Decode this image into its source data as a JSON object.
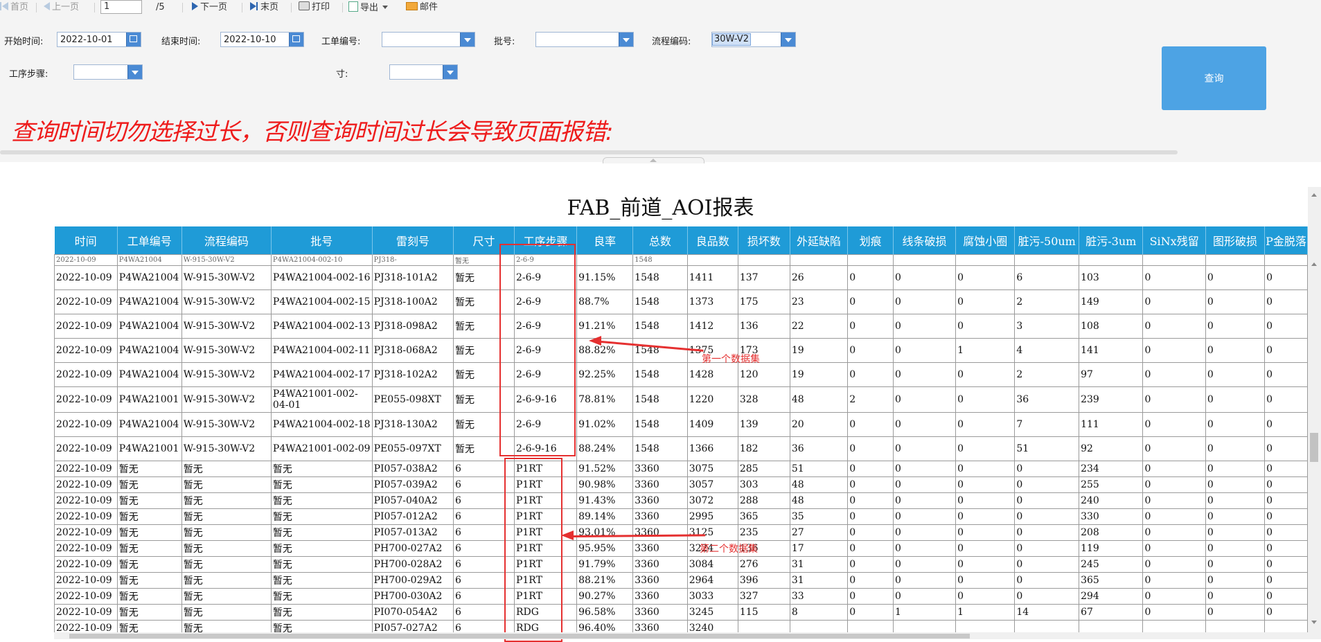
{
  "toolbar": {
    "first": "首页",
    "prev": "上一页",
    "page_value": "1",
    "page_total": "/5",
    "next": "下一页",
    "last": "末页",
    "print": "打印",
    "export": "导出",
    "mail": "邮件",
    "icons": [
      "first-icon",
      "prev-icon",
      "next-icon",
      "last-icon",
      "print-icon",
      "export-icon",
      "dropdown-icon",
      "mail-icon"
    ]
  },
  "filters": {
    "start_label": "开始时间:",
    "start_value": "2022-10-01",
    "end_label": "结束时间:",
    "end_value": "2022-10-10",
    "workorder_label": "工单编号:",
    "workorder_value": "",
    "batch_label": "批号:",
    "batch_value": "",
    "flow_label": "流程编码:",
    "flow_value": "30W-V2",
    "step_label": "工序步骤:",
    "step_value": "",
    "size_label": "寸:",
    "size_value": "",
    "query_button": "查询"
  },
  "warning": "查询时间切勿选择过长，否则查询时间过长会导致页面报错:",
  "report": {
    "title": "FAB_前道_AOI报表",
    "columns": [
      "时间",
      "工单编号",
      "流程编码",
      "批号",
      "雷刻号",
      "尺寸",
      "工序步骤",
      "良率",
      "总数",
      "良品数",
      "损坏数",
      "外延缺陷",
      "划痕",
      "线条破损",
      "腐蚀小圈",
      "脏污-50um",
      "脏污-3um",
      "SiNx残留",
      "图形破损",
      "P金脱落"
    ],
    "partial_top_row": [
      "2022-10-09",
      "P4WA21004",
      "W-915-30W-V2",
      "P4WA21004-002-10",
      "PJ318-",
      "暂无",
      "2-6-9",
      "",
      "1548",
      "",
      "",
      "",
      "",
      "",
      "",
      "",
      "",
      "",
      "",
      ""
    ],
    "rows_set1": [
      [
        "2022-10-09",
        "P4WA21004",
        "W-915-30W-V2",
        "P4WA21004-002-16",
        "PJ318-101A2",
        "暂无",
        "2-6-9",
        "91.15%",
        "1548",
        "1411",
        "137",
        "26",
        "0",
        "0",
        "0",
        "6",
        "103",
        "0",
        "0",
        "0"
      ],
      [
        "2022-10-09",
        "P4WA21004",
        "W-915-30W-V2",
        "P4WA21004-002-15",
        "PJ318-100A2",
        "暂无",
        "2-6-9",
        "88.7%",
        "1548",
        "1373",
        "175",
        "23",
        "0",
        "0",
        "0",
        "2",
        "149",
        "0",
        "0",
        "0"
      ],
      [
        "2022-10-09",
        "P4WA21004",
        "W-915-30W-V2",
        "P4WA21004-002-13",
        "PJ318-098A2",
        "暂无",
        "2-6-9",
        "91.21%",
        "1548",
        "1412",
        "136",
        "22",
        "0",
        "0",
        "0",
        "3",
        "108",
        "0",
        "0",
        "0"
      ],
      [
        "2022-10-09",
        "P4WA21004",
        "W-915-30W-V2",
        "P4WA21004-002-11",
        "PJ318-068A2",
        "暂无",
        "2-6-9",
        "88.82%",
        "1548",
        "1375",
        "173",
        "19",
        "0",
        "0",
        "1",
        "4",
        "141",
        "0",
        "0",
        "0"
      ],
      [
        "2022-10-09",
        "P4WA21004",
        "W-915-30W-V2",
        "P4WA21004-002-17",
        "PJ318-102A2",
        "暂无",
        "2-6-9",
        "92.25%",
        "1548",
        "1428",
        "120",
        "19",
        "0",
        "0",
        "0",
        "2",
        "97",
        "0",
        "0",
        "0"
      ],
      [
        "2022-10-09",
        "P4WA21001",
        "W-915-30W-V2",
        "P4WA21001-002-04-01",
        "PE055-098XT",
        "暂无",
        "2-6-9-16",
        "78.81%",
        "1548",
        "1220",
        "328",
        "48",
        "2",
        "0",
        "0",
        "36",
        "239",
        "0",
        "0",
        "0"
      ],
      [
        "2022-10-09",
        "P4WA21004",
        "W-915-30W-V2",
        "P4WA21004-002-18",
        "PJ318-130A2",
        "暂无",
        "2-6-9",
        "91.02%",
        "1548",
        "1409",
        "139",
        "20",
        "0",
        "0",
        "0",
        "7",
        "111",
        "0",
        "0",
        "0"
      ],
      [
        "2022-10-09",
        "P4WA21001",
        "W-915-30W-V2",
        "P4WA21001-002-09",
        "PE055-097XT",
        "暂无",
        "2-6-9-16",
        "88.24%",
        "1548",
        "1366",
        "182",
        "36",
        "0",
        "0",
        "0",
        "51",
        "92",
        "0",
        "0",
        "0"
      ]
    ],
    "rows_set2": [
      [
        "2022-10-09",
        "暂无",
        "暂无",
        "暂无",
        "PI057-038A2",
        "6",
        "P1RT",
        "91.52%",
        "3360",
        "3075",
        "285",
        "51",
        "0",
        "0",
        "0",
        "0",
        "234",
        "0",
        "0",
        "0"
      ],
      [
        "2022-10-09",
        "暂无",
        "暂无",
        "暂无",
        "PI057-039A2",
        "6",
        "P1RT",
        "90.98%",
        "3360",
        "3057",
        "303",
        "48",
        "0",
        "0",
        "0",
        "0",
        "255",
        "0",
        "0",
        "0"
      ],
      [
        "2022-10-09",
        "暂无",
        "暂无",
        "暂无",
        "PI057-040A2",
        "6",
        "P1RT",
        "91.43%",
        "3360",
        "3072",
        "288",
        "48",
        "0",
        "0",
        "0",
        "0",
        "240",
        "0",
        "0",
        "0"
      ],
      [
        "2022-10-09",
        "暂无",
        "暂无",
        "暂无",
        "PI057-012A2",
        "6",
        "P1RT",
        "89.14%",
        "3360",
        "2995",
        "365",
        "35",
        "0",
        "0",
        "0",
        "0",
        "330",
        "0",
        "0",
        "0"
      ],
      [
        "2022-10-09",
        "暂无",
        "暂无",
        "暂无",
        "PI057-013A2",
        "6",
        "P1RT",
        "93.01%",
        "3360",
        "3125",
        "235",
        "27",
        "0",
        "0",
        "0",
        "0",
        "208",
        "0",
        "0",
        "0"
      ],
      [
        "2022-10-09",
        "暂无",
        "暂无",
        "暂无",
        "PH700-027A2",
        "6",
        "P1RT",
        "95.95%",
        "3360",
        "3224",
        "136",
        "17",
        "0",
        "0",
        "0",
        "0",
        "119",
        "0",
        "0",
        "0"
      ],
      [
        "2022-10-09",
        "暂无",
        "暂无",
        "暂无",
        "PH700-028A2",
        "6",
        "P1RT",
        "91.79%",
        "3360",
        "3084",
        "276",
        "31",
        "0",
        "0",
        "0",
        "0",
        "245",
        "0",
        "0",
        "0"
      ],
      [
        "2022-10-09",
        "暂无",
        "暂无",
        "暂无",
        "PH700-029A2",
        "6",
        "P1RT",
        "88.21%",
        "3360",
        "2964",
        "396",
        "31",
        "0",
        "0",
        "0",
        "0",
        "365",
        "0",
        "0",
        "0"
      ],
      [
        "2022-10-09",
        "暂无",
        "暂无",
        "暂无",
        "PH700-030A2",
        "6",
        "P1RT",
        "90.27%",
        "3360",
        "3033",
        "327",
        "33",
        "0",
        "0",
        "0",
        "0",
        "294",
        "0",
        "0",
        "0"
      ],
      [
        "2022-10-09",
        "暂无",
        "暂无",
        "暂无",
        "PI070-054A2",
        "6",
        "RDG",
        "96.58%",
        "3360",
        "3245",
        "115",
        "8",
        "0",
        "1",
        "1",
        "14",
        "67",
        "0",
        "0",
        "0"
      ]
    ],
    "partial_bottom_row": [
      "2022-10-09",
      "暂无",
      "暂无",
      "暂无",
      "PI057-027A2",
      "6",
      "RDG",
      "96.40%",
      "3360",
      "3240",
      "",
      "",
      "",
      "",
      "",
      "",
      "",
      "",
      "",
      ""
    ]
  },
  "annotations": {
    "set1": "第一个数据集",
    "set2": "第二个数据集",
    "color": "#e53030"
  },
  "colors": {
    "header_bg": "#1f9bd7",
    "query_button": "#4da3e4",
    "warning_text": "#ee1c1c"
  }
}
